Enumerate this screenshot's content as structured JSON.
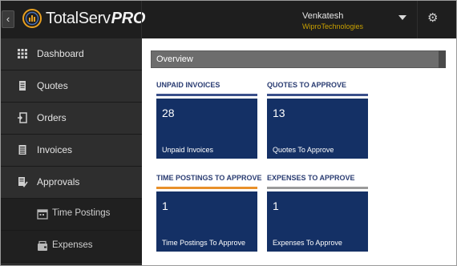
{
  "header": {
    "brand_name": "TotalServ",
    "brand_suffix": "PRO",
    "user_name": "Venkatesh",
    "user_org": "WiproTechnologies"
  },
  "icons": {
    "back": "chevron-left-icon",
    "user_menu": "caret-down-icon",
    "settings": "gear-icon"
  },
  "sidebar": {
    "items": [
      {
        "label": "Dashboard",
        "icon": "grid-icon",
        "type": "main"
      },
      {
        "label": "Quotes",
        "icon": "document-icon",
        "type": "main"
      },
      {
        "label": "Orders",
        "icon": "orders-icon",
        "type": "main"
      },
      {
        "label": "Invoices",
        "icon": "invoice-icon",
        "type": "main"
      },
      {
        "label": "Approvals",
        "icon": "approval-icon",
        "type": "main"
      },
      {
        "label": "Time Postings",
        "icon": "calendar-icon",
        "type": "sub"
      },
      {
        "label": "Expenses",
        "icon": "wallet-icon",
        "type": "sub"
      }
    ]
  },
  "overview": {
    "title": "Overview",
    "sections": [
      {
        "label": "UNPAID INVOICES",
        "count": "28",
        "caption": "Unpaid Invoices",
        "accent": "#3a4f8a"
      },
      {
        "label": "QUOTES TO APPROVE",
        "count": "13",
        "caption": "Quotes To Approve",
        "accent": "#3a4f8a"
      },
      {
        "label": "TIME POSTINGS TO APPROVE",
        "count": "1",
        "caption": "Time Postings To Approve",
        "accent": "#e8902a"
      },
      {
        "label": "EXPENSES TO APPROVE",
        "count": "1",
        "caption": "Expenses To Approve",
        "accent": "#9a9a9a"
      }
    ]
  },
  "colors": {
    "header_bg": "#1e1e1e",
    "sidebar_bg": "#2b2b2b",
    "tile_bg": "#143065",
    "section_label": "#2a3c72",
    "org_text": "#c8a000"
  }
}
